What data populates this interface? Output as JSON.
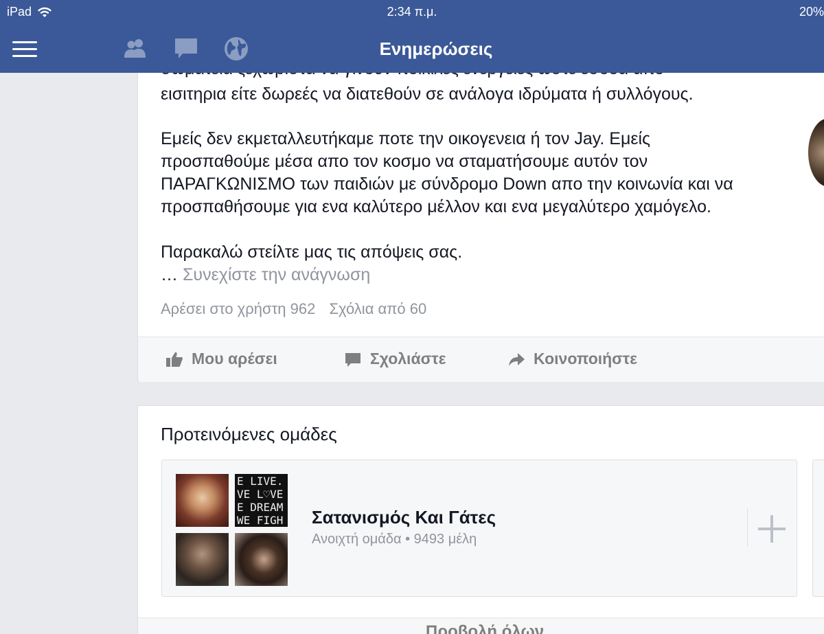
{
  "status_bar": {
    "device": "iPad",
    "time": "2:34 π.μ.",
    "battery": "20%"
  },
  "nav": {
    "title": "Ενημερώσεις",
    "icons": [
      "menu-icon",
      "friends-icon",
      "messages-icon",
      "globe-icon"
    ]
  },
  "post": {
    "cut_line": "σωματεία ξεχωριστα να γίνουν ποικιλες ενεργειες ώστε εσοδα απο",
    "para1": [
      "εισιτηρια είτε δωρεές να διατεθούν σε ανάλογα ιδρύματα ή συλλόγους."
    ],
    "para2": [
      "Εμείς δεν εκμεταλλευτήκαμε ποτε την οικογενεια ή τον Jay. Εμείς",
      "προσπαθούμε μέσα απο τον κοσμο να σταματήσουμε αυτόν τον",
      "ΠΑΡΑΓΚΩΝΙΣΜΟ των παιδιών με σύνδρομο Down απο την κοινωνία και να",
      "προσπαθήσουμε για ενα καλύτερο μέλλον και ενα μεγαλύτερο χαμόγελο."
    ],
    "para3": "Παρακαλώ στείλτε μας τις απόψεις σας.",
    "ellipsis": "…",
    "see_more": "Συνεχίστε την ανάγνωση",
    "likes": "Αρέσει στο χρήστη 962",
    "comments": "Σχόλια από 60",
    "actions": {
      "like": "Μου αρέσει",
      "comment": "Σχολιάστε",
      "share": "Κοινοποιήστε"
    }
  },
  "groups": {
    "title": "Προτεινόμενες ομάδες",
    "item": {
      "name": "Σατανισμός Και Γάτες",
      "meta": "Ανοιχτή ομάδα • 9493 μέλη",
      "thumb_text": [
        "E LIVE.",
        "VE L♡VE",
        "E DREAM",
        "WE FIGH"
      ]
    },
    "view_all": "Προβολή όλων"
  },
  "colors": {
    "brand": "#3b5998",
    "muted": "#90949c"
  }
}
